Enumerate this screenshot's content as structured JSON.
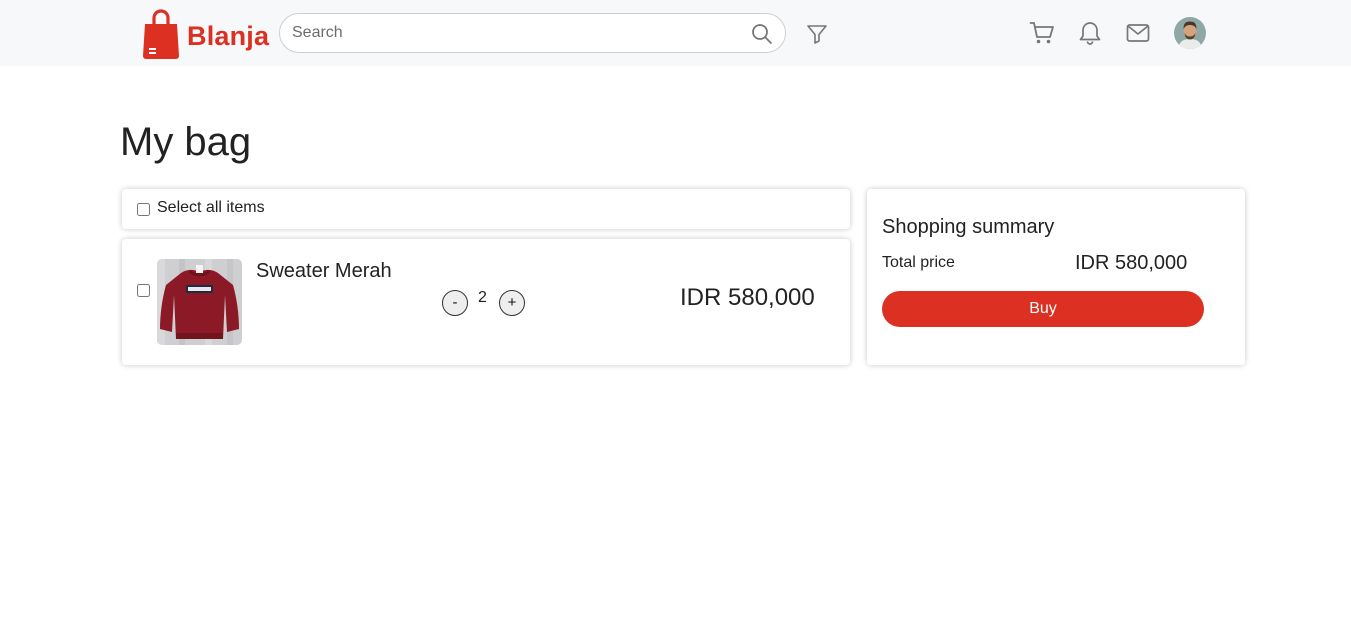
{
  "brand": {
    "name": "Blanja",
    "color": "#db3022",
    "logo_icon": "shopping-bag-icon"
  },
  "search": {
    "placeholder": "Search",
    "value": "",
    "icon": "search-icon"
  },
  "nav_icons": [
    "filter-icon",
    "cart-icon",
    "bell-icon",
    "mail-icon",
    "avatar"
  ],
  "page": {
    "title": "My bag"
  },
  "select_all": {
    "label": "Select all items",
    "checked": false
  },
  "items": [
    {
      "name": "Sweater Merah",
      "quantity": "2",
      "price": "IDR 580,000",
      "checked": false,
      "minus_label": "-",
      "plus_label": "+"
    }
  ],
  "summary": {
    "title": "Shopping summary",
    "total_label": "Total price",
    "total_value": "IDR 580,000",
    "buy_label": "Buy"
  },
  "colors": {
    "accent": "#db3022",
    "navbar_bg": "#f7f8fa",
    "sweater": "#8b1a26"
  }
}
